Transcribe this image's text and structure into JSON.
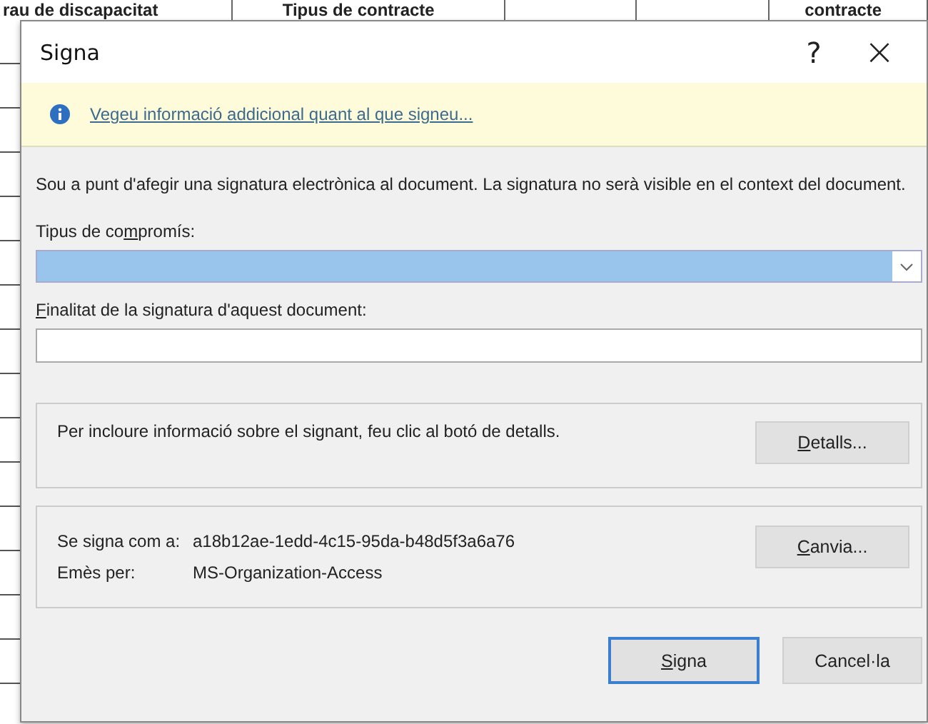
{
  "background_sheet": {
    "headers": [
      "rau de discapacitat",
      "Tipus de contracte",
      "contracte"
    ]
  },
  "window": {
    "title": "Signa",
    "help": "?",
    "close": "×"
  },
  "info_bar": {
    "link": "Vegeu informació addicional quant al que signeu..."
  },
  "intro": "Sou a punt d'afegir una signatura electrònica al document. La signatura no serà visible en el context del document.",
  "commitment": {
    "label": {
      "before": "Tipus de co",
      "key": "m",
      "after": "promís:"
    },
    "selected": true
  },
  "purpose": {
    "label": {
      "key": "F",
      "after": "inalitat de la signatura d'aquest document:"
    }
  },
  "details_group": {
    "text": "Per incloure informació sobre el signant, feu clic al botó de detalls.",
    "button": {
      "key": "D",
      "after": "etalls..."
    }
  },
  "signer_group": {
    "rows": [
      {
        "label": "Se signa com a:",
        "value": "a18b12ae-1edd-4c15-95da-b48d5f3a6a76"
      },
      {
        "label": "Emès per:",
        "value": "MS-Organization-Access"
      }
    ],
    "button": {
      "key": "C",
      "after": "anvia..."
    }
  },
  "buttons": [
    {
      "label": {
        "key": "S",
        "after": "igna"
      },
      "default": true
    },
    {
      "label": {
        "before": "Cancel·la"
      },
      "default": false
    }
  ]
}
